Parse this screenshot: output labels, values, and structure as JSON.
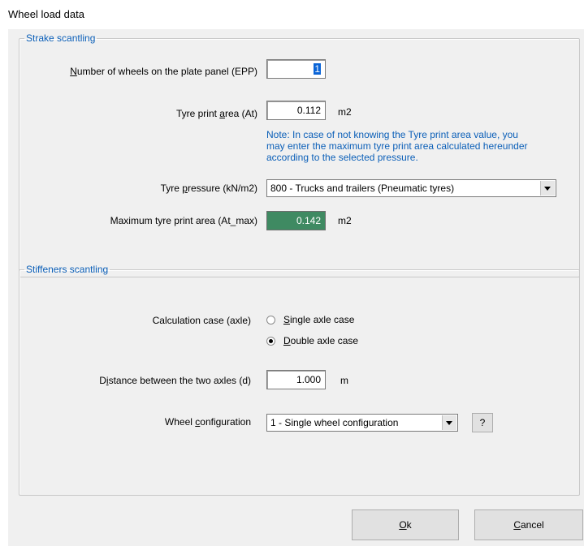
{
  "window": {
    "title": "Wheel load data"
  },
  "strake": {
    "legend": "Strake scantling",
    "wheels_label_ul": "N",
    "wheels_label_rest": "umber of wheels on the plate panel (EPP)",
    "wheels_value": "1",
    "tyre_area_label_a": "Tyre print ",
    "tyre_area_label_ul": "a",
    "tyre_area_label_b": "rea (At)",
    "tyre_area_value": "0.112",
    "tyre_area_unit": "m2",
    "note_line1": "Note: In case of not knowing the Tyre print area value, you",
    "note_line2": "may enter the maximum tyre print area calculated hereunder",
    "note_line3": "according to the selected pressure.",
    "pressure_label_a": "Tyre ",
    "pressure_label_ul": "p",
    "pressure_label_b": "ressure (kN/m2)",
    "pressure_value": "800 - Trucks and trailers (Pneumatic tyres)",
    "max_area_label": "Maximum tyre print area (At_max)",
    "max_area_value": "0.142",
    "max_area_unit": "m2"
  },
  "stiffeners": {
    "legend": "Stiffeners scantling",
    "calc_case_label": "Calculation case (axle)",
    "single_ul": "S",
    "single_rest": "ingle axle case",
    "single_checked": false,
    "double_ul": "D",
    "double_rest": "ouble axle case",
    "double_checked": true,
    "distance_label_a": "D",
    "distance_label_ul": "i",
    "distance_label_b": "stance between the two axles (d)",
    "distance_value": "1.000",
    "distance_unit": "m",
    "config_label_a": "Wheel ",
    "config_label_ul": "c",
    "config_label_b": "onfiguration",
    "config_value": "1 - Single wheel configuration",
    "help_label": "?"
  },
  "buttons": {
    "ok_ul": "O",
    "ok_rest": "k",
    "cancel_ul": "C",
    "cancel_rest": "ancel"
  }
}
